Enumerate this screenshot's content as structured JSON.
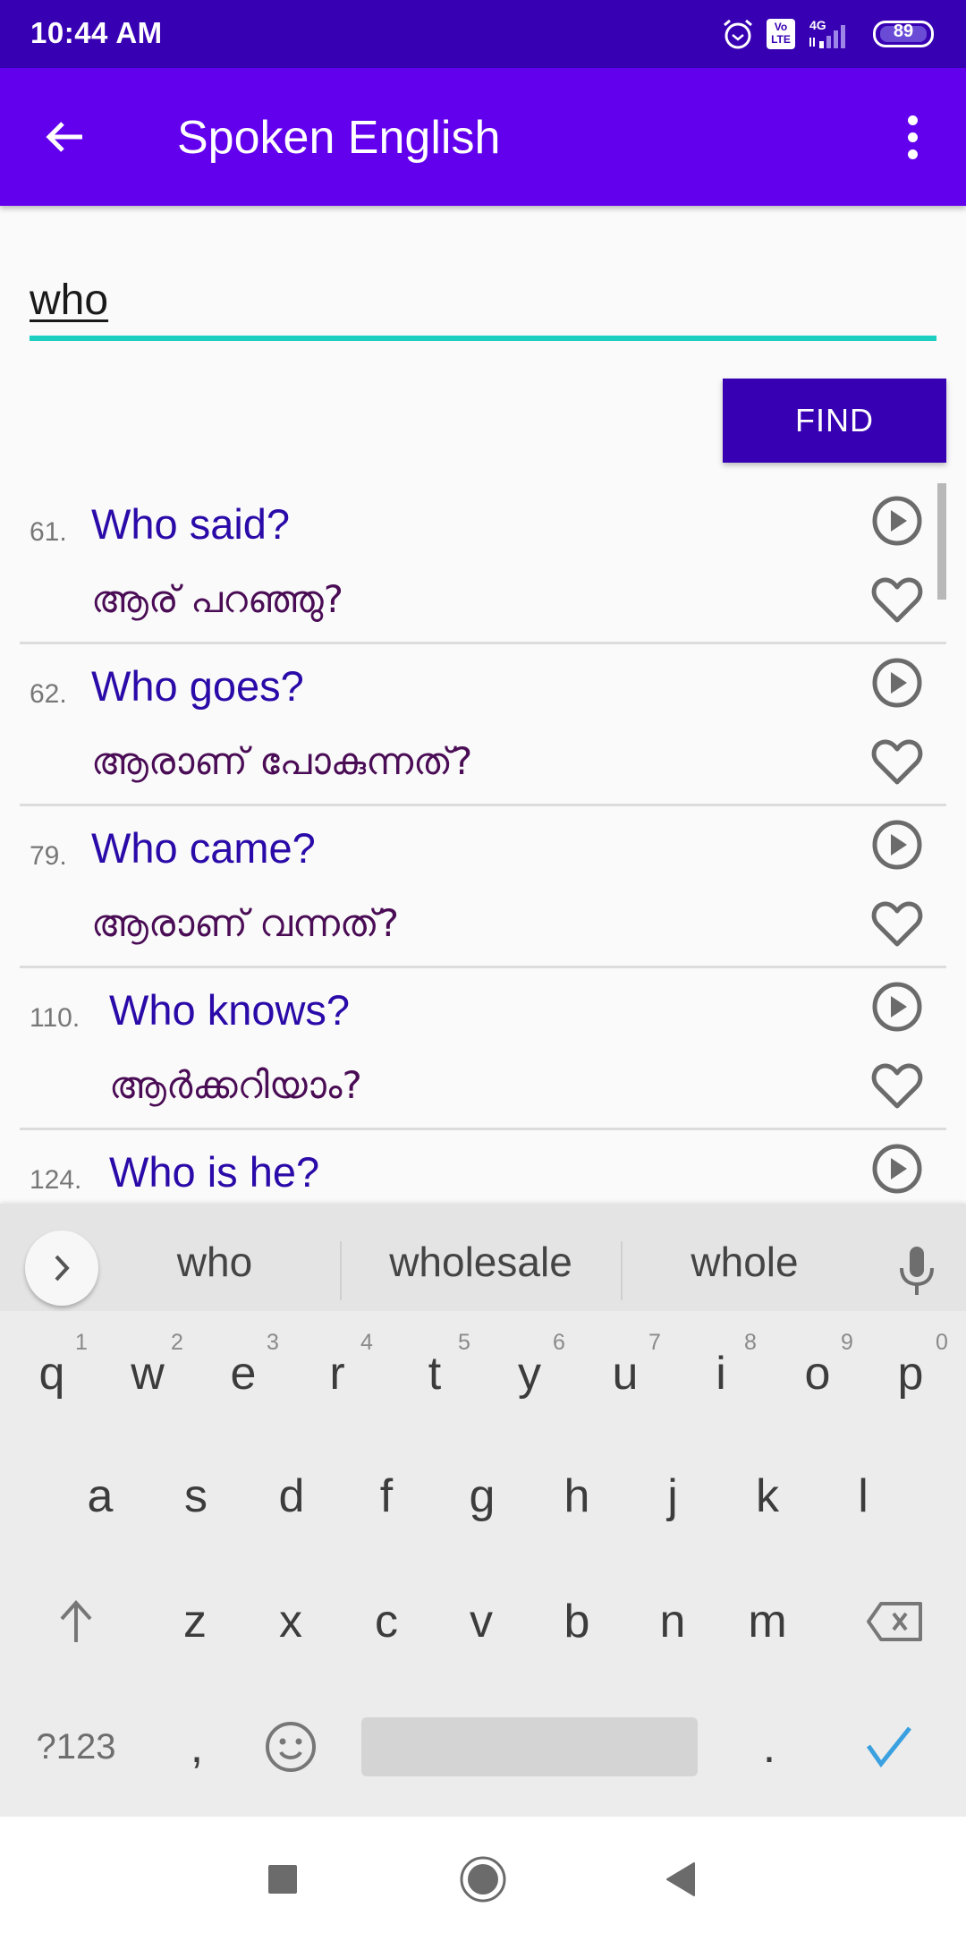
{
  "status_bar": {
    "time": "10:44 AM",
    "network": "4G",
    "volte": "Vo LTE",
    "battery": "89",
    "icons": [
      "alarm-icon",
      "volte-icon",
      "signal-icon",
      "battery-icon"
    ]
  },
  "app_bar": {
    "title": "Spoken English",
    "back_icon": "arrow-left-icon",
    "menu_icon": "more-vert-icon"
  },
  "search": {
    "value": "who",
    "placeholder": "",
    "button_label": "FIND"
  },
  "colors": {
    "status_bar": "#3700b3",
    "app_bar": "#6200ee",
    "accent_underline": "#1ccfc0",
    "english_text": "#2a0aa8",
    "malayalam_text": "#4a0c55",
    "keyboard_bg": "#ececec",
    "done_check": "#3aa0e0"
  },
  "results": [
    {
      "number": "61.",
      "english": "Who said?",
      "malayalam": "ആര് പറഞ്ഞു?"
    },
    {
      "number": "62.",
      "english": "Who goes?",
      "malayalam": "ആരാണ് പോകുന്നത്?"
    },
    {
      "number": "79.",
      "english": "Who came?",
      "malayalam": "ആരാണ് വന്നത്?"
    },
    {
      "number": "110.",
      "english": "Who knows?",
      "malayalam": "ആർക്കറിയാം?"
    },
    {
      "number": "124.",
      "english": "Who is he?",
      "malayalam": ""
    }
  ],
  "keyboard": {
    "suggestions": [
      "who",
      "wholesale",
      "whole"
    ],
    "row1": [
      {
        "key": "q",
        "hint": "1"
      },
      {
        "key": "w",
        "hint": "2"
      },
      {
        "key": "e",
        "hint": "3"
      },
      {
        "key": "r",
        "hint": "4"
      },
      {
        "key": "t",
        "hint": "5"
      },
      {
        "key": "y",
        "hint": "6"
      },
      {
        "key": "u",
        "hint": "7"
      },
      {
        "key": "i",
        "hint": "8"
      },
      {
        "key": "o",
        "hint": "9"
      },
      {
        "key": "p",
        "hint": "0"
      }
    ],
    "row2": [
      "a",
      "s",
      "d",
      "f",
      "g",
      "h",
      "j",
      "k",
      "l"
    ],
    "row3": [
      "z",
      "x",
      "c",
      "v",
      "b",
      "n",
      "m"
    ],
    "symbols_label": "?123",
    "comma": ",",
    "period": "."
  }
}
